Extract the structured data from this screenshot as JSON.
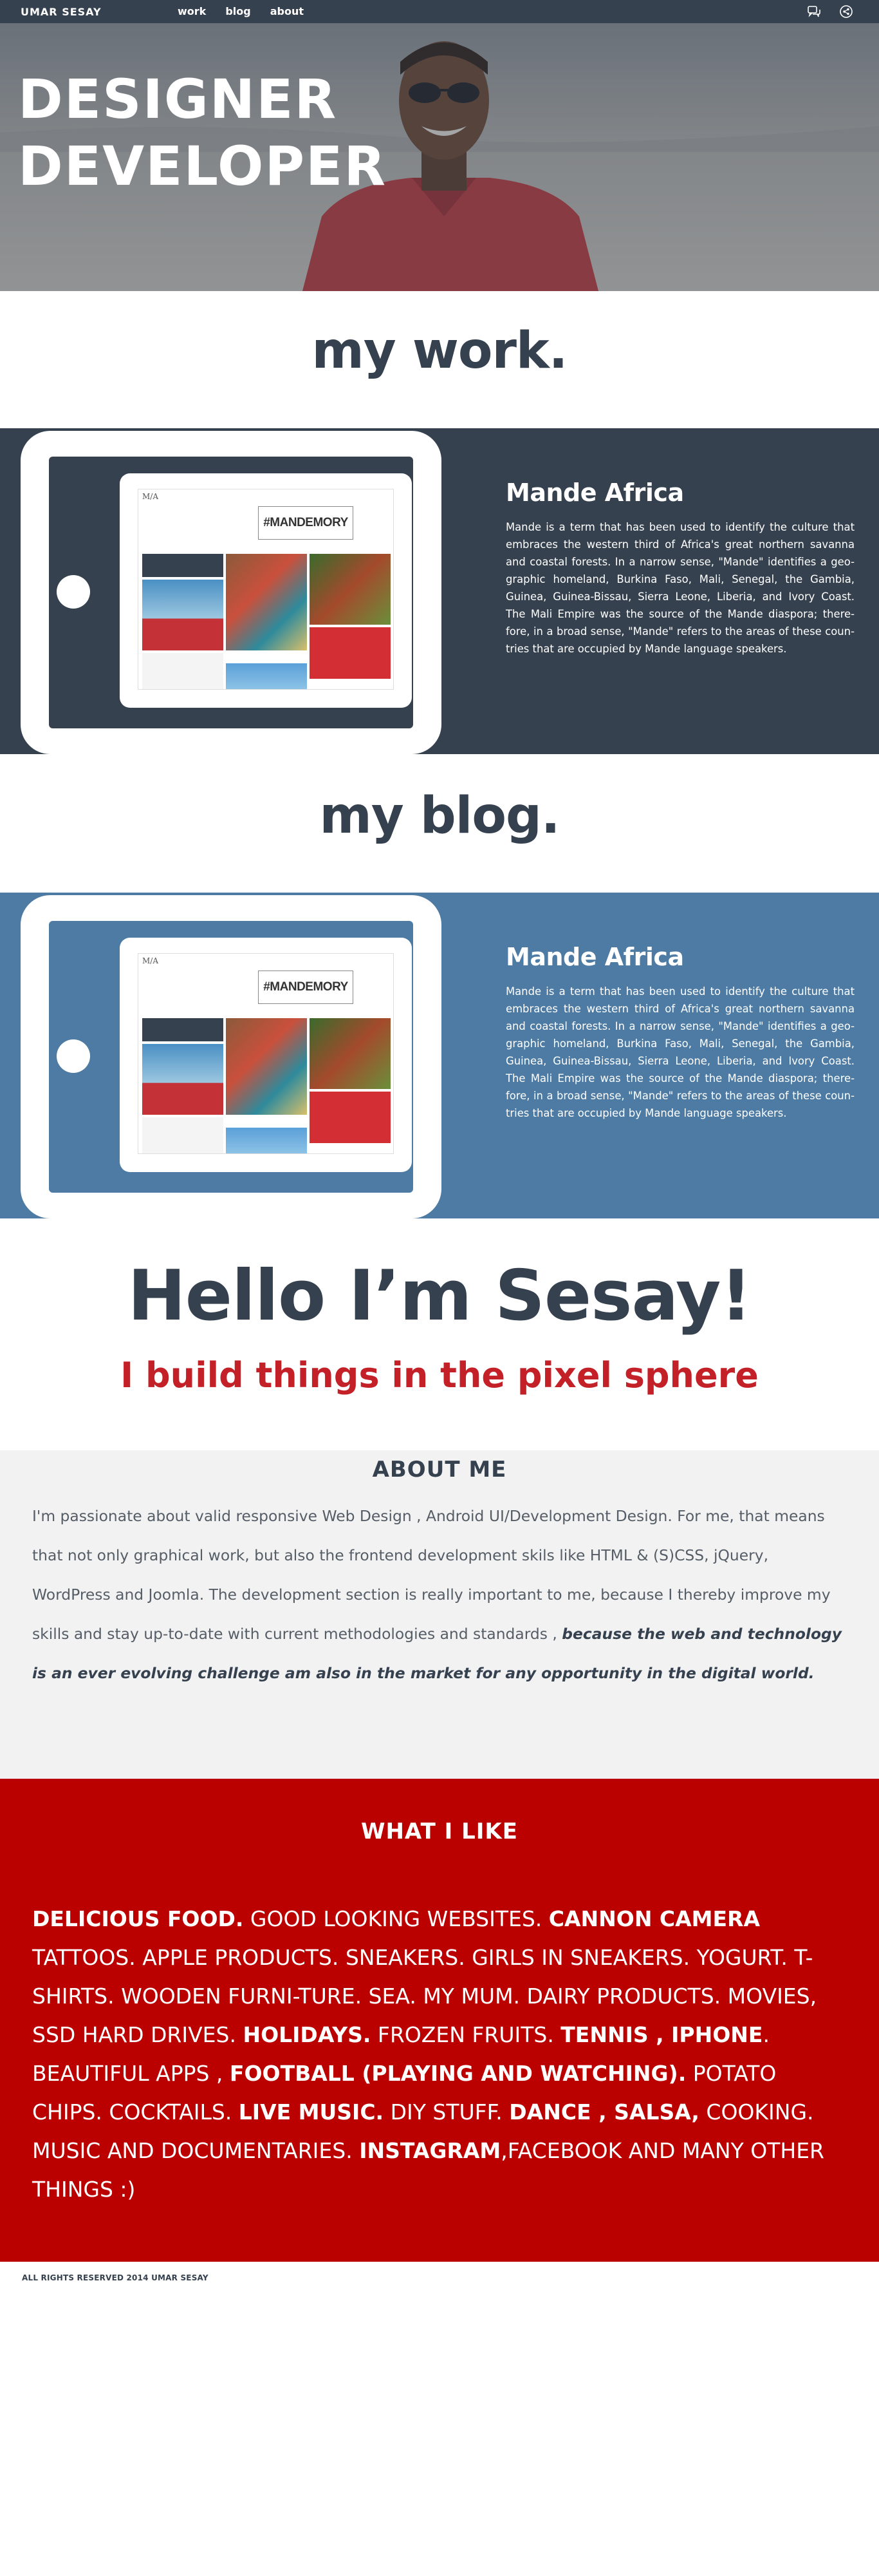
{
  "nav": {
    "brand": "UMAR  SESAY",
    "links": [
      "work",
      "blog",
      "about"
    ],
    "icons": [
      "chat-icon",
      "share-icon"
    ]
  },
  "hero": {
    "title_line1": "DESIGNER",
    "title_line2": "DEVELOPER"
  },
  "work": {
    "heading": "my work.",
    "project": {
      "title": "Mande Africa",
      "description": "Mande is a term that has been used to identify the culture that embraces the western third of Africa's great northern savanna and coastal forests. In a narrow sense, \"Mande\" identifies a geo-graphic homeland, Burkina Faso, Mali, Senegal, the Gambia, Guinea, Guinea-Bissau, Sierra Leone, Liberia, and Ivory Coast. The Mali Empire was the source of the Mande diaspora; there-fore, in a broad sense, \"Mande\" refers to the areas of these coun-tries that are occupied by Mande language speakers.",
      "screen_logo": "M/A",
      "screen_tag": "#MANDEMORY"
    }
  },
  "blog": {
    "heading": "my blog.",
    "post": {
      "title": "Mande Africa",
      "description": "Mande is a term that has been used to identify the culture that embraces the western third of Africa's great northern savanna and coastal forests. In a narrow sense, \"Mande\" identifies a geo-graphic homeland, Burkina Faso, Mali, Senegal, the Gambia, Guinea, Guinea-Bissau, Sierra Leone, Liberia, and Ivory Coast. The Mali Empire was the source of the Mande diaspora; there-fore, in a broad sense, \"Mande\" refers to the areas of these coun-tries that are occupied by Mande language speakers.",
      "screen_logo": "M/A",
      "screen_tag": "#MANDEMORY"
    }
  },
  "intro": {
    "hello": "Hello I’m Sesay!",
    "tagline": "I build things in the pixel sphere"
  },
  "about": {
    "title": "ABOUT ME",
    "text": "I'm passionate about valid responsive Web Design , Android UI/Development Design. For me, that means that not only graphical work, but also the frontend development skils like HTML & (S)CSS, jQuery, WordPress and Joomla. The development section is really important to me, because I thereby  improve my skills and stay up-to-date with current methodologies and standards ,",
    "emphasis": "because the web and technology is an ever evolving challenge am also in the market for any opportunity in the digital world."
  },
  "likes": {
    "title": "WHAT I LIKE",
    "items": [
      {
        "text": "DELICIOUS FOOD.",
        "bold": true
      },
      {
        "text": " GOOD LOOKING WEBSITES. ",
        "bold": false
      },
      {
        "text": "CANNON CAMERA",
        "bold": true
      },
      {
        "text": " TATTOOS. APPLE PRODUCTS. SNEAKERS. GIRLS IN SNEAKERS. YOGURT. T-SHIRTS. WOODEN FURNI-TURE. SEA. MY MUM. DAIRY PRODUCTS. MOVIES, SSD HARD DRIVES. ",
        "bold": false
      },
      {
        "text": "HOLIDAYS.",
        "bold": true
      },
      {
        "text": " FROZEN FRUITS. ",
        "bold": false
      },
      {
        "text": "TENNIS , IPHONE",
        "bold": true
      },
      {
        "text": ". BEAUTIFUL APPS , ",
        "bold": false
      },
      {
        "text": "FOOTBALL (PLAYING AND WATCHING).",
        "bold": true
      },
      {
        "text": " POTATO CHIPS. COCKTAILS. ",
        "bold": false
      },
      {
        "text": "LIVE MUSIC.",
        "bold": true
      },
      {
        "text": " DIY STUFF. ",
        "bold": false
      },
      {
        "text": "DANCE , SALSA,",
        "bold": true
      },
      {
        "text": " COOKING.  MUSIC AND DOCUMENTARIES. ",
        "bold": false
      },
      {
        "text": "INSTAGRAM",
        "bold": true
      },
      {
        "text": ",FACEBOOK AND MANY OTHER THINGS :)",
        "bold": false
      }
    ]
  },
  "footer": {
    "copyright": "ALL RIGHTS RESERVED 2014 UMAR SESAY"
  },
  "colors": {
    "navy": "#36414f",
    "steel_blue": "#4d7ba3",
    "accent_red": "#c42028",
    "likes_red": "#bb0000",
    "about_bg": "#f2f2f3"
  }
}
